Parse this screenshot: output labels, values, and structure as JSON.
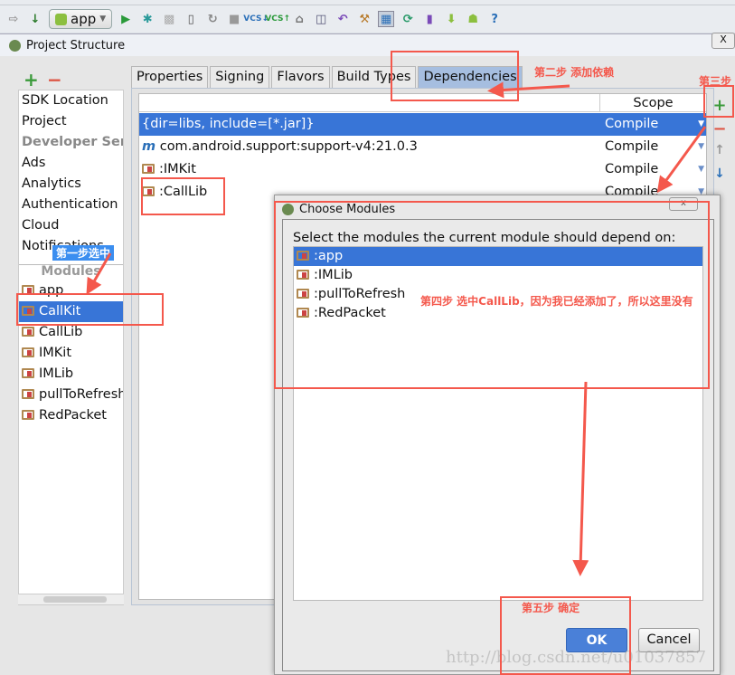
{
  "toolbar": {
    "run_config": "app",
    "icons": [
      "forward-arrow-icon",
      "make-icon",
      "android-icon",
      "run-icon",
      "debug-icon",
      "attach-icon",
      "device-icon",
      "rerun-icon",
      "stop-icon",
      "vcs-update-icon",
      "vcs-commit-icon",
      "vcs-history-icon",
      "compare-icon",
      "revert-icon",
      "settings-icon",
      "project-structure-icon",
      "sync-icon",
      "avd-manager-icon",
      "sdk-manager-icon",
      "android-monitor-icon",
      "help-icon"
    ]
  },
  "window": {
    "title": "Project Structure",
    "close": "X"
  },
  "sidebar": {
    "add": "+",
    "remove": "−",
    "items": [
      {
        "label": "SDK Location"
      },
      {
        "label": "Project"
      },
      {
        "label": "Developer Services",
        "section": true
      },
      {
        "label": "Ads"
      },
      {
        "label": "Analytics"
      },
      {
        "label": "Authentication"
      },
      {
        "label": "Cloud"
      },
      {
        "label": "Notifications"
      }
    ],
    "modules_header": "Modules",
    "modules": [
      {
        "label": "app"
      },
      {
        "label": "CallKit",
        "selected": true
      },
      {
        "label": "CallLib"
      },
      {
        "label": "IMKit"
      },
      {
        "label": "IMLib"
      },
      {
        "label": "pullToRefresh"
      },
      {
        "label": "RedPacket"
      }
    ]
  },
  "tabs": [
    {
      "label": "Properties"
    },
    {
      "label": "Signing"
    },
    {
      "label": "Flavors"
    },
    {
      "label": "Build Types"
    },
    {
      "label": "Dependencies",
      "active": true
    }
  ],
  "dependencies": {
    "scope_header": "Scope",
    "rows": [
      {
        "name": "{dir=libs, include=[*.jar]}",
        "scope": "Compile",
        "selected": true
      },
      {
        "name": "com.android.support:support-v4:21.0.3",
        "scope": "Compile",
        "prefix": "m"
      },
      {
        "name": ":IMKit",
        "scope": "Compile"
      },
      {
        "name": ":CallLib",
        "scope": "Compile"
      }
    ],
    "buttons": {
      "add": "+",
      "remove": "−",
      "up": "↑",
      "down": "↓"
    }
  },
  "dialog": {
    "title": "Choose Modules",
    "close": "x",
    "label": "Select the modules the current module should depend on:",
    "modules": [
      {
        "label": ":app",
        "selected": true
      },
      {
        "label": ":IMLib"
      },
      {
        "label": ":pullToRefresh"
      },
      {
        "label": ":RedPacket"
      }
    ],
    "ok": "OK",
    "cancel": "Cancel"
  },
  "annotations": {
    "step1": "第一步选中",
    "step2": "第二步  添加依赖",
    "step3": "第三步",
    "step4": "第四步  选中CallLib，因为我已经添加了，所以这里没有",
    "step5": "第五步  确定"
  },
  "watermark": "http://blog.csdn.net/u01037857",
  "colors": {
    "selection": "#3875d7",
    "annotation": "#f4584c",
    "ok_button": "#4a80d8",
    "add_green": "#3a9a3a"
  }
}
